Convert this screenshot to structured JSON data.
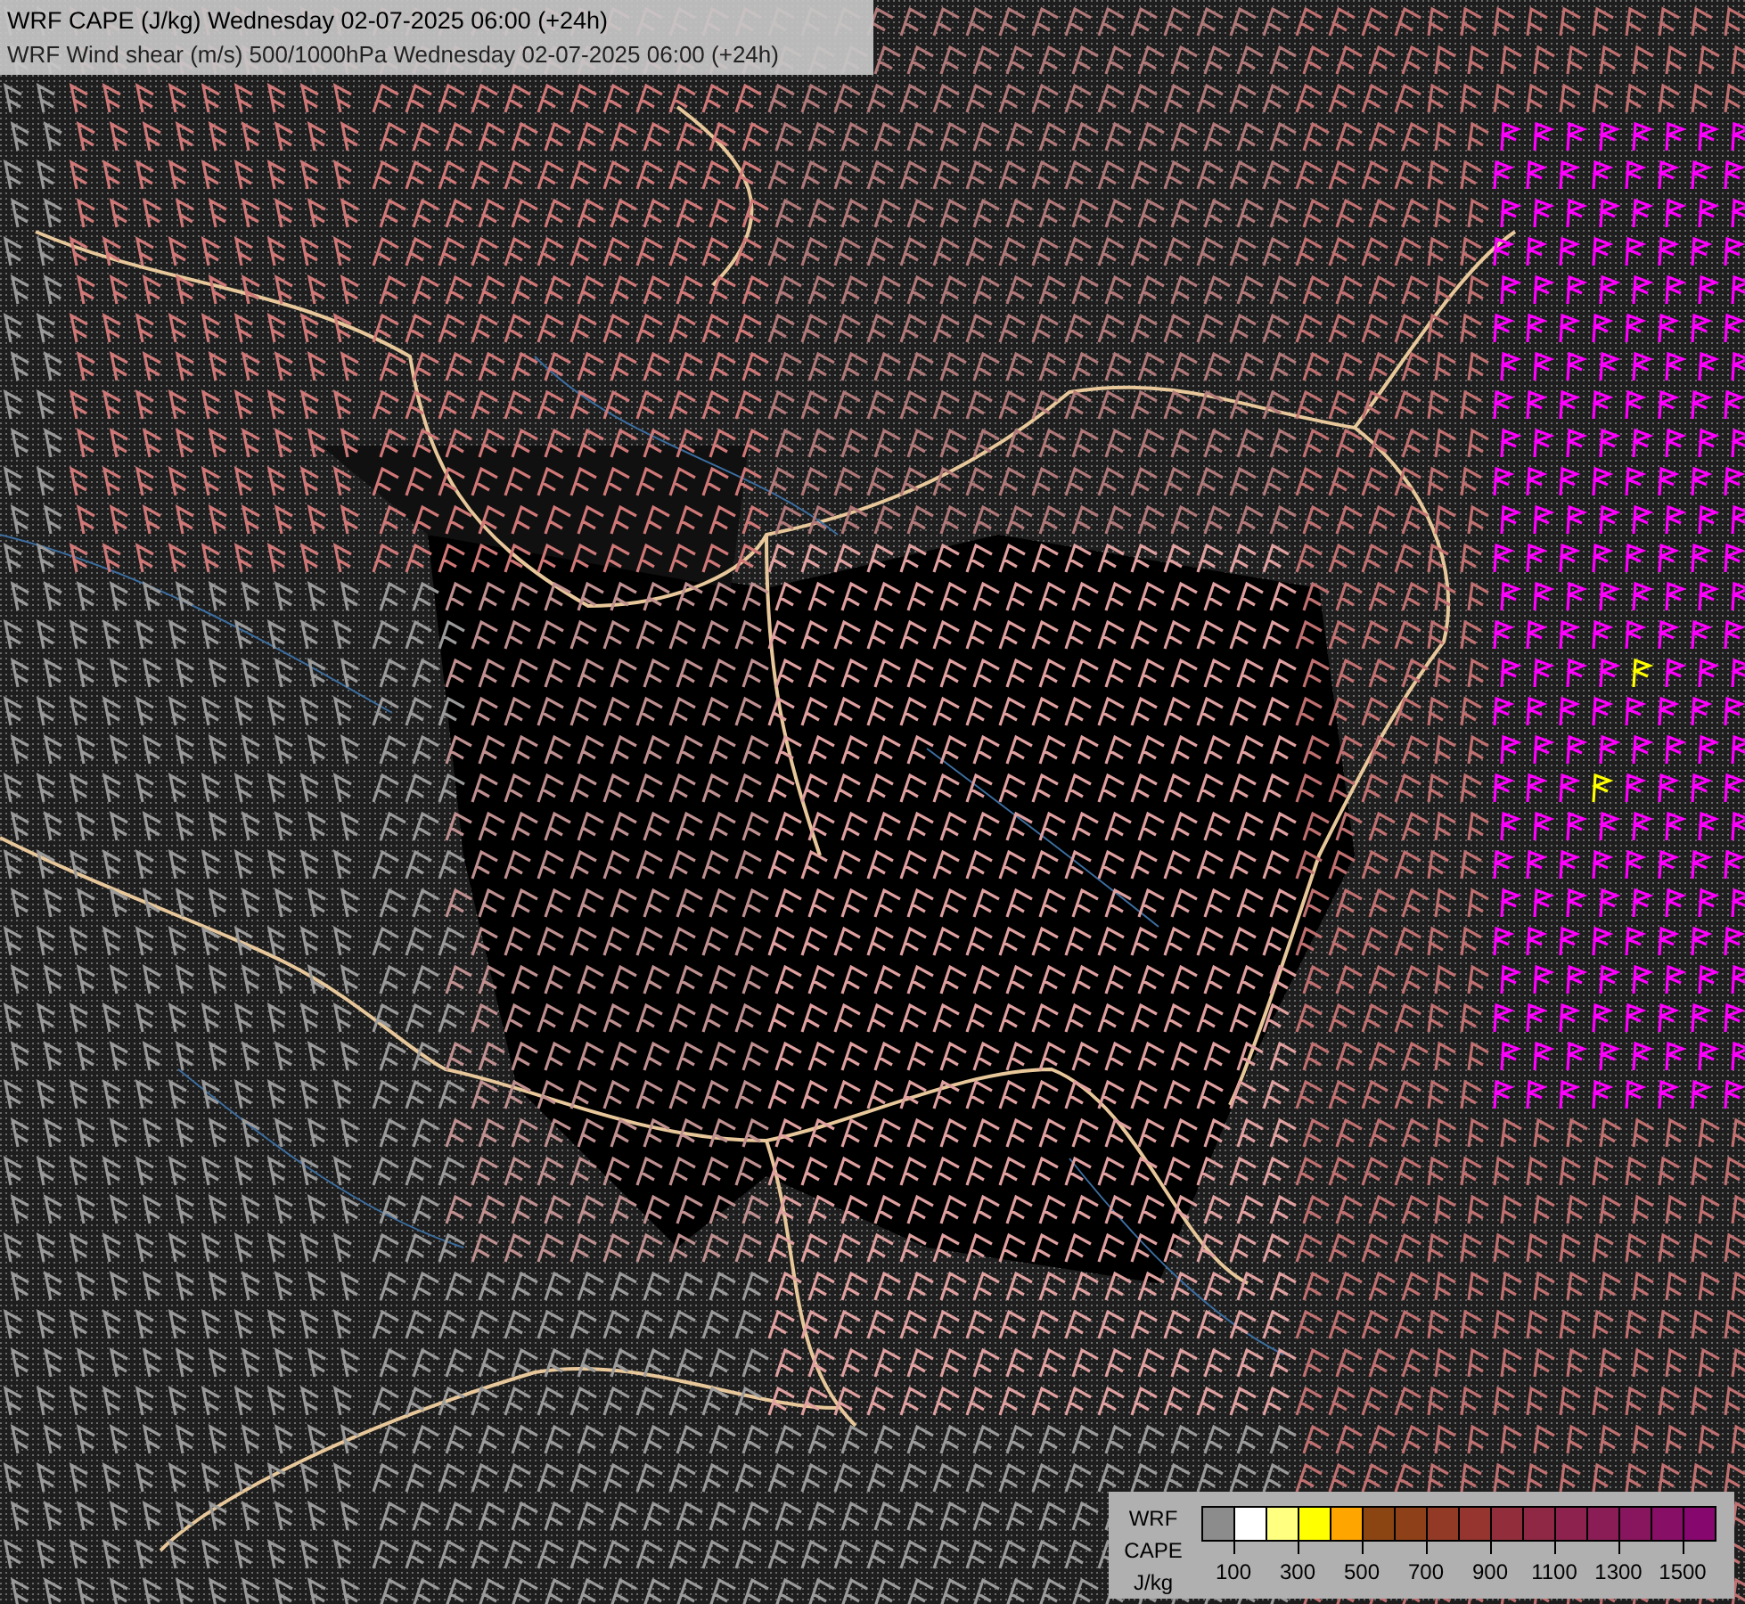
{
  "title_lines": [
    "WRF CAPE (J/kg) Wednesday 02-07-2025 06:00 (+24h)",
    "WRF Wind shear (m/s) 500/1000hPa Wednesday 02-07-2025 06:00 (+24h)"
  ],
  "legend": {
    "label_lines": [
      "WRF",
      "CAPE",
      "J/kg"
    ],
    "swatches": [
      {
        "color": "#8c8c8c"
      },
      {
        "color": "#ffffff"
      },
      {
        "color": "#ffff80"
      },
      {
        "color": "#ffff00"
      },
      {
        "color": "#ffa500"
      },
      {
        "color": "#8b4513"
      },
      {
        "color": "#8e4019"
      },
      {
        "color": "#923a26"
      },
      {
        "color": "#963430"
      },
      {
        "color": "#922e3b"
      },
      {
        "color": "#8f2844"
      },
      {
        "color": "#8c224d"
      },
      {
        "color": "#8a1c56"
      },
      {
        "color": "#88165e"
      },
      {
        "color": "#870f66"
      },
      {
        "color": "#86086e"
      }
    ],
    "ticks": [
      "100",
      "300",
      "500",
      "700",
      "900",
      "1100",
      "1300",
      "1500"
    ]
  }
}
